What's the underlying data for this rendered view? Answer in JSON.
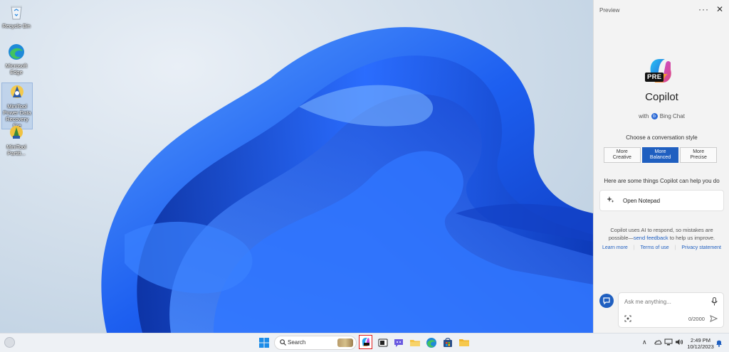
{
  "desktop": {
    "icons": [
      {
        "label": "Recycle Bin",
        "icon": "recycle-bin-icon"
      },
      {
        "label": "Microsoft Edge",
        "icon": "edge-icon"
      },
      {
        "label": "MiniTool Power Data Recovery Fre",
        "icon": "minitool-data-recovery-icon"
      },
      {
        "label": "MiniTool Partiti...",
        "icon": "minitool-partition-icon"
      }
    ]
  },
  "panel": {
    "header": "Preview",
    "more_label": "···",
    "close_label": "✕",
    "logo_badge": "PRE",
    "title": "Copilot",
    "with_label": "with",
    "bing_label": "Bing Chat",
    "style_heading": "Choose a conversation style",
    "styles": [
      {
        "line1": "More",
        "line2": "Creative"
      },
      {
        "line1": "More",
        "line2": "Balanced"
      },
      {
        "line1": "More",
        "line2": "Precise"
      }
    ],
    "active_style": 1,
    "help_heading": "Here are some things Copilot can help you do",
    "suggestion": "Open Notepad",
    "disclaimer_a": "Copilot uses AI to respond, so mistakes are possible—",
    "disclaimer_link": "send feedback",
    "disclaimer_b": " to help us improve.",
    "links": [
      "Learn more",
      "Terms of use",
      "Privacy statement"
    ],
    "chat": {
      "placeholder": "Ask me anything...",
      "counter": "0/2000"
    }
  },
  "taskbar": {
    "search_label": "Search",
    "time": "2:49 PM",
    "date": "10/12/2023",
    "tray_arrow": "∧",
    "apps": [
      "start-icon",
      "copilot-icon",
      "task-view-icon",
      "chat-icon",
      "file-explorer-icon",
      "edge-icon",
      "store-icon",
      "folder-icon"
    ]
  },
  "colors": {
    "accent": "#1f5fc0",
    "highlight": "#e01b1b",
    "desktop_blue": "#1a5de8"
  }
}
